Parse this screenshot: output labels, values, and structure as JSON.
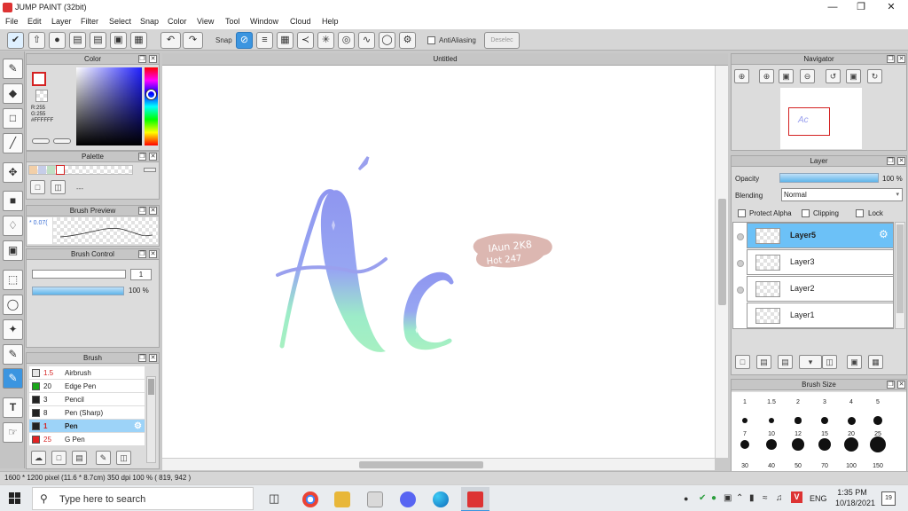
{
  "window": {
    "title": "JUMP PAINT (32bit)",
    "controls": [
      "minimize-icon",
      "restore-icon",
      "close-icon"
    ]
  },
  "menu": [
    "File",
    "Edit",
    "Layer",
    "Filter",
    "Select",
    "Snap",
    "Color",
    "View",
    "Tool",
    "Window",
    "Cloud",
    "Help"
  ],
  "toolbar": {
    "snap_label": "Snap",
    "antialias_label": "AntiAliasing",
    "deselect_label": "Deselec"
  },
  "color_panel": {
    "title": "Color",
    "r_label": "R:255",
    "g_label": "G:255",
    "hex": "#FFFFFF"
  },
  "palette_panel": {
    "title": "Palette",
    "more": "---",
    "swatches": [
      "#f2cfa8",
      "#c6cde8",
      "#bfe0c4",
      "#ffffff"
    ]
  },
  "brush_preview_panel": {
    "title": "Brush Preview",
    "size_text": "* 0.07("
  },
  "brush_control_panel": {
    "title": "Brush Control",
    "size_value": "1",
    "opacity_text": "100 %",
    "opacity": 1.0
  },
  "brush_panel": {
    "title": "Brush",
    "items": [
      {
        "size": "1.5",
        "name": "Airbrush",
        "color": "#e6e6e6",
        "selected": false
      },
      {
        "size": "20",
        "name": "Edge Pen",
        "color": "#19a619",
        "selected": false
      },
      {
        "size": "3",
        "name": "Pencil",
        "color": "#222222",
        "selected": false
      },
      {
        "size": "8",
        "name": "Pen (Sharp)",
        "color": "#222222",
        "selected": false
      },
      {
        "size": "1",
        "name": "Pen",
        "color": "#222222",
        "selected": true
      },
      {
        "size": "25",
        "name": "G Pen",
        "color": "#e22222",
        "selected": false
      }
    ]
  },
  "canvas": {
    "tab_title": "Untitled",
    "watermark_line1": "IAun 2K8",
    "watermark_line2": "Hot 247"
  },
  "navigator_panel": {
    "title": "Navigator"
  },
  "layer_panel": {
    "title": "Layer",
    "opacity_label": "Opacity",
    "opacity_text": "100 %",
    "opacity": 1.0,
    "blending_label": "Blending",
    "blending_value": "Normal",
    "protect_alpha_label": "Protect Alpha",
    "clipping_label": "Clipping",
    "lock_label": "Lock",
    "layers": [
      {
        "name": "Layer5",
        "selected": true
      },
      {
        "name": "Layer3",
        "selected": false
      },
      {
        "name": "Layer2",
        "selected": false
      },
      {
        "name": "Layer1",
        "selected": false
      }
    ]
  },
  "brush_size_panel": {
    "title": "Brush Size",
    "rows": [
      [
        "1",
        "1.5",
        "2",
        "3",
        "4",
        "5"
      ],
      [
        "7",
        "10",
        "12",
        "15",
        "20",
        "25"
      ],
      [
        "30",
        "40",
        "50",
        "70",
        "100",
        "150"
      ]
    ]
  },
  "statusbar": {
    "text": "1600 * 1200 pixel  (11.6 * 8.7cm)  350 dpi  100 %  ( 819, 942 )"
  },
  "taskbar": {
    "search_placeholder": "Type here to search",
    "language": "ENG",
    "time": "1:35 PM",
    "date": "10/18/2021",
    "notifications": "19"
  }
}
